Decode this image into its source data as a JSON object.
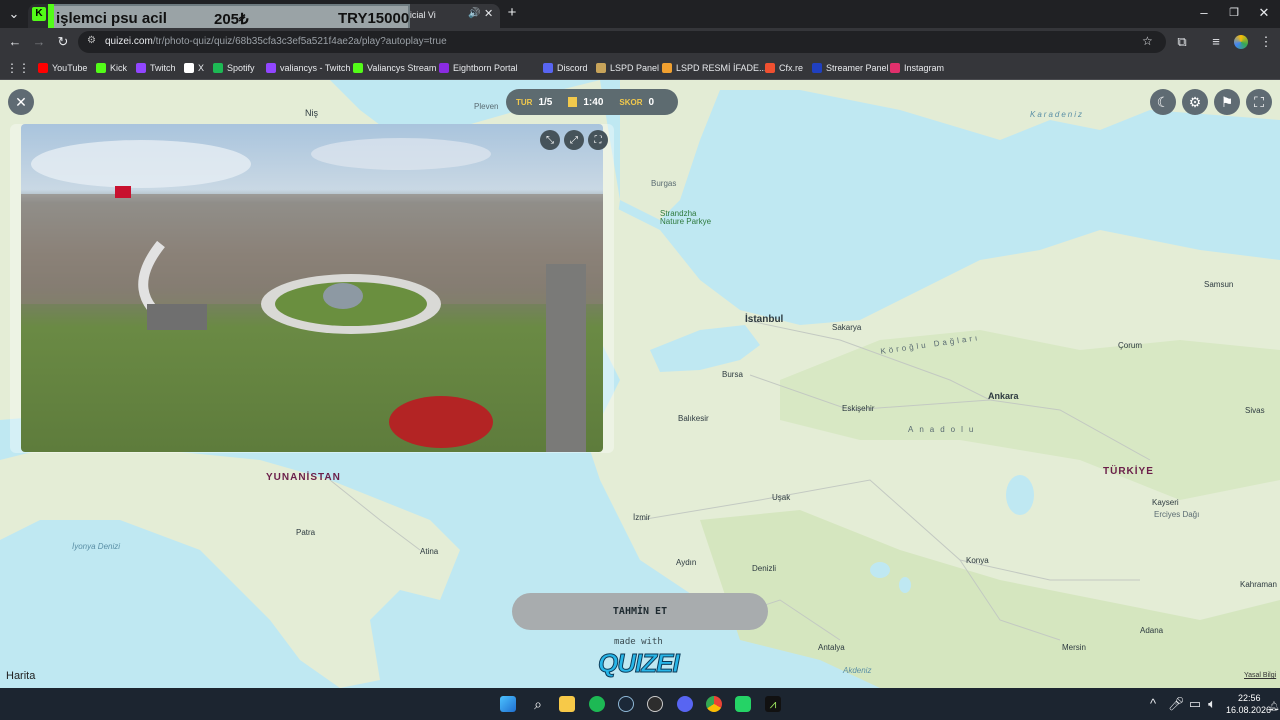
{
  "overlay": {
    "line1": "işlemci psu acil",
    "price1": "205₺",
    "price2": "TRY15000"
  },
  "tabs": {
    "active_title": "fon (Official Vi"
  },
  "address": {
    "domain": "quizei.com",
    "path": "/tr/photo-quiz/quiz/68b35cfa3c3ef5a521f4ae2a/play?autoplay=true"
  },
  "bookmarks": [
    {
      "label": "YouTube",
      "color": "#ff0000"
    },
    {
      "label": "Kick",
      "color": "#53fc18"
    },
    {
      "label": "Twitch",
      "color": "#9146ff"
    },
    {
      "label": "X",
      "color": "#ffffff"
    },
    {
      "label": "Spotify",
      "color": "#1db954"
    },
    {
      "label": "valiancys - Twitch",
      "color": "#9146ff"
    },
    {
      "label": "Valiancys Stream",
      "color": "#53fc18"
    },
    {
      "label": "Eightborn Portal",
      "color": "#8a2be2"
    },
    {
      "label": "Discord",
      "color": "#5865f2"
    },
    {
      "label": "LSPD Panel",
      "color": "#c8a45a"
    },
    {
      "label": "LSPD  RESMİ İFADE...",
      "color": "#f0a030"
    },
    {
      "label": "Cfx.re",
      "color": "#f05030"
    },
    {
      "label": "Streamer Panel",
      "color": "#2040c0"
    },
    {
      "label": "Instagram",
      "color": "#e1306c"
    }
  ],
  "hud": {
    "tur_label": "TUR",
    "tur_value": "1/5",
    "time": "1:40",
    "skor_label": "SKOR",
    "skor_value": "0"
  },
  "guess_button": "TAHMİN ET",
  "made_with": "made with",
  "brand": "QUIZEI",
  "map_attrib": "Harita",
  "legal": "Yasal Bilgi",
  "map": {
    "countries": [
      "YUNANİSTAN",
      "TÜRKİYE"
    ],
    "cities": [
      "Niş",
      "Pleven",
      "Burgas",
      "İstanbul",
      "Sakarya",
      "Bursa",
      "Balıkesir",
      "Eskişehir",
      "Ankara",
      "Samsun",
      "Çorum",
      "Sivas",
      "Kayseri",
      "Uşak",
      "İzmir",
      "Aydın",
      "Denizli",
      "Konya",
      "Antalya",
      "Mersin",
      "Adana",
      "Kahraman",
      "Patra",
      "Atina",
      "İyonya Denizi",
      "Strandzha Nature Parkye",
      "Erciyes Dağı",
      "Köroğlu Dağları",
      "Anadolu",
      "Karadeniz",
      "Akdeniz"
    ]
  },
  "taskbar": {
    "time": "22:56",
    "date": "16.08.2026"
  }
}
